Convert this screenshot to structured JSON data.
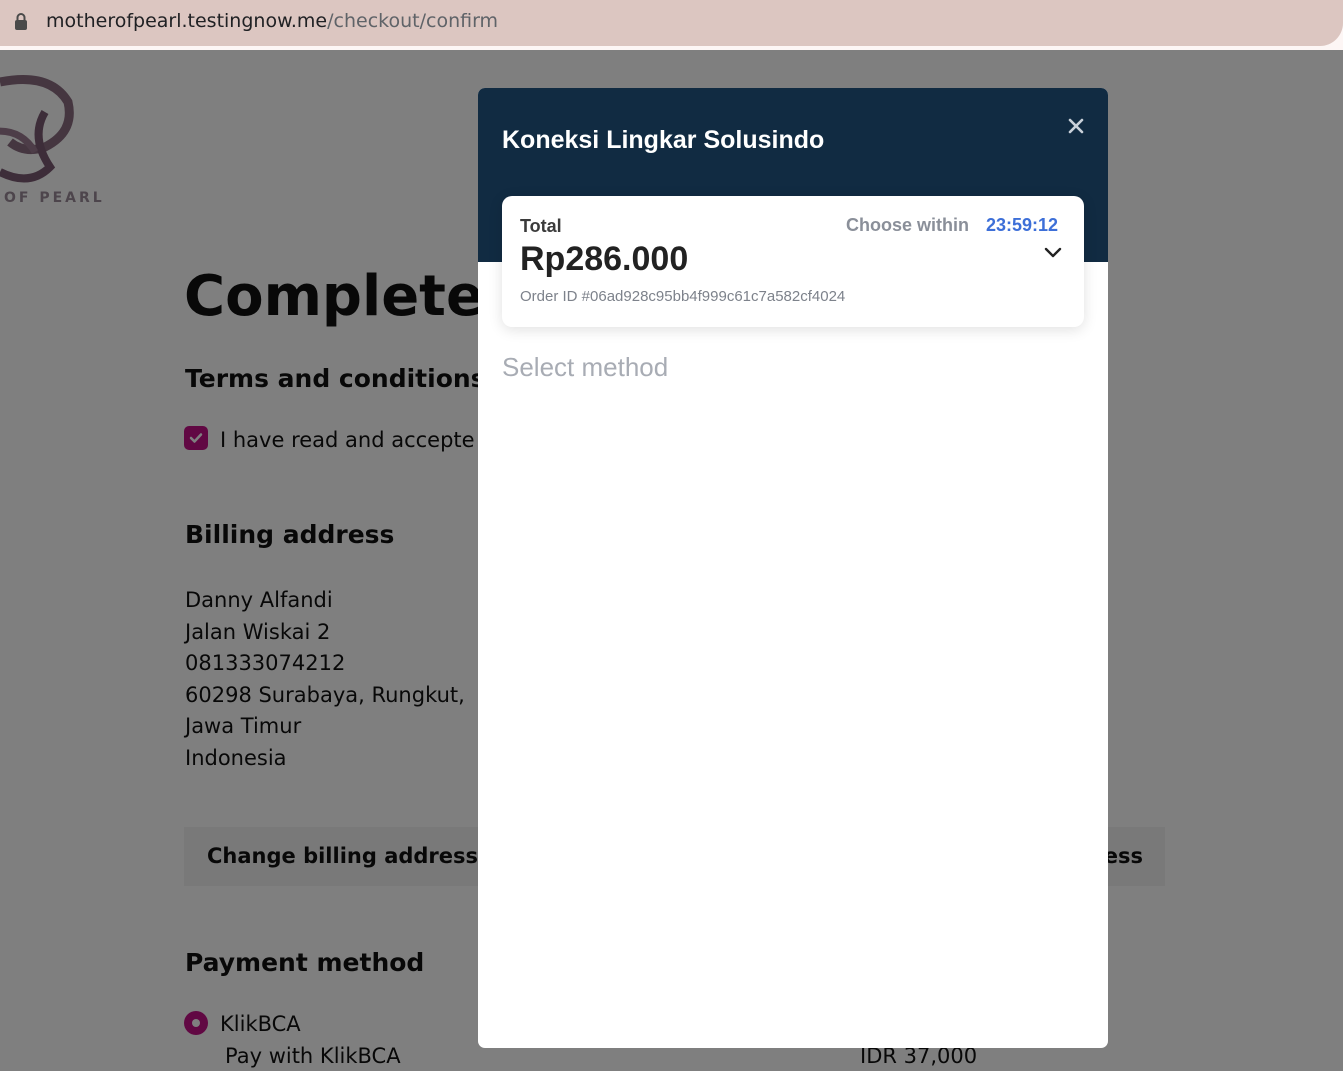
{
  "browser": {
    "url_host": "motherofpearl.testingnow.me",
    "url_path": "/checkout/confirm"
  },
  "page": {
    "logo_text": "OF PEARL",
    "title": "Complete",
    "terms_heading": "Terms and conditions",
    "terms_checkbox_label": "I have read and accepte",
    "billing_heading": "Billing address",
    "billing_lines": [
      "Danny Alfandi",
      "Jalan Wiskai 2",
      "081333074212",
      "60298 Surabaya, Rungkut,",
      "Jawa Timur",
      "Indonesia"
    ],
    "change_billing_button": "Change billing address",
    "change_shipping_button_partial": "ess",
    "payment_heading": "Payment method",
    "payment_option_label": "KlikBCA",
    "payment_option_desc": "Pay with KlikBCA",
    "payment_option_price": "IDR 37,000"
  },
  "modal": {
    "merchant_name": "Koneksi Lingkar Solusindo",
    "total_label": "Total",
    "choose_within_label": "Choose within",
    "countdown": "23:59:12",
    "amount": "Rp286.000",
    "order_id": "Order ID #06ad928c95bb4f999c61c7a582cf4024",
    "select_method": "Select method"
  },
  "icons": {
    "lock": "lock-icon",
    "close": "close-icon",
    "chevron": "chevron-down-icon",
    "check": "check-icon"
  },
  "colors": {
    "modal_header": "#112b42",
    "accent_magenta": "#c21187",
    "timer_blue": "#3d6fd8"
  }
}
